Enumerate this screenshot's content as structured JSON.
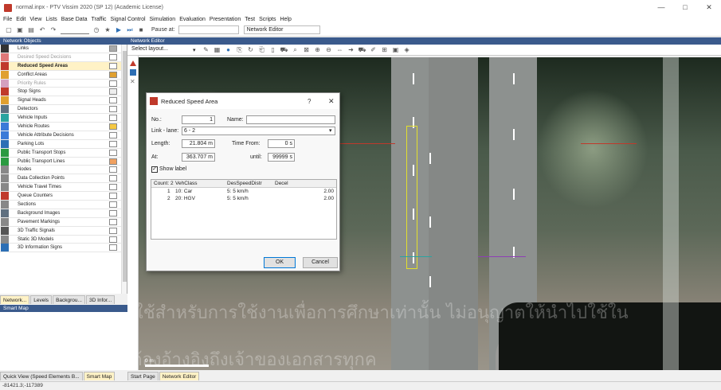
{
  "window": {
    "title": "normal.inpx - PTV Vissim 2020 (SP 12) (Academic License)",
    "minimize": "—",
    "maximize": "□",
    "close": "✕"
  },
  "menu": [
    "File",
    "Edit",
    "View",
    "Lists",
    "Base Data",
    "Traffic",
    "Signal Control",
    "Simulation",
    "Evaluation",
    "Presentation",
    "Test",
    "Scripts",
    "Help"
  ],
  "toolbar": {
    "pause_at_label": "Pause at:",
    "pause_at_value": "",
    "layout_combo": "Network Editor"
  },
  "network_objects": {
    "header": "Network Objects",
    "items": [
      {
        "label": "Links",
        "dim": false,
        "selected": false
      },
      {
        "label": "Desired Speed Decisions",
        "dim": true,
        "selected": false
      },
      {
        "label": "Reduced Speed Areas",
        "dim": false,
        "selected": true
      },
      {
        "label": "Conflict Areas",
        "dim": false,
        "selected": false
      },
      {
        "label": "Priority Rules",
        "dim": true,
        "selected": false
      },
      {
        "label": "Stop Signs",
        "dim": false,
        "selected": false
      },
      {
        "label": "Signal Heads",
        "dim": false,
        "selected": false
      },
      {
        "label": "Detectors",
        "dim": false,
        "selected": false
      },
      {
        "label": "Vehicle Inputs",
        "dim": false,
        "selected": false
      },
      {
        "label": "Vehicle Routes",
        "dim": false,
        "selected": false
      },
      {
        "label": "Vehicle Attribute Decisions",
        "dim": false,
        "selected": false
      },
      {
        "label": "Parking Lots",
        "dim": false,
        "selected": false
      },
      {
        "label": "Public Transport Stops",
        "dim": false,
        "selected": false
      },
      {
        "label": "Public Transport Lines",
        "dim": false,
        "selected": false
      },
      {
        "label": "Nodes",
        "dim": false,
        "selected": false
      },
      {
        "label": "Data Collection Points",
        "dim": false,
        "selected": false
      },
      {
        "label": "Vehicle Travel Times",
        "dim": false,
        "selected": false
      },
      {
        "label": "Queue Counters",
        "dim": false,
        "selected": false
      },
      {
        "label": "Sections",
        "dim": false,
        "selected": false
      },
      {
        "label": "Background Images",
        "dim": false,
        "selected": false
      },
      {
        "label": "Pavement Markings",
        "dim": false,
        "selected": false
      },
      {
        "label": "3D Traffic Signals",
        "dim": false,
        "selected": false
      },
      {
        "label": "Static 3D Models",
        "dim": false,
        "selected": false
      },
      {
        "label": "3D Information Signs",
        "dim": false,
        "selected": false
      }
    ],
    "tabs": [
      "Network...",
      "Levels",
      "Backgrou...",
      "3D Infor..."
    ]
  },
  "smart_map": {
    "header": "Smart Map",
    "tabs": [
      "Quick View (Speed Elements B...",
      "Smart Map"
    ]
  },
  "network_editor": {
    "header": "Network Editor",
    "layout_placeholder": "Select layout...",
    "tabs": [
      "Start Page",
      "Network Editor"
    ],
    "scale_label": "0 m"
  },
  "dialog": {
    "title": "Reduced Speed Area",
    "help": "?",
    "close": "✕",
    "no_label": "No.:",
    "no_value": "1",
    "name_label": "Name:",
    "name_value": "",
    "link_lane_label": "Link - lane:",
    "link_lane_value": "6 - 2",
    "length_label": "Length:",
    "length_value": "21.804 m",
    "at_label": "At:",
    "at_value": "363.707 m",
    "time_from_label": "Time From:",
    "time_from_value": "0 s",
    "until_label": "until:",
    "until_value": "99999 s",
    "show_label": "Show label",
    "grid": {
      "headers": [
        "Count: 2",
        "VehClass",
        "DesSpeedDistr",
        "Decel"
      ],
      "rows": [
        {
          "n": "1",
          "vehclass": "10: Car",
          "speed": "5: 5 km/h",
          "decel": "2.00"
        },
        {
          "n": "2",
          "vehclass": "20: HGV",
          "speed": "5: 5 km/h",
          "decel": "2.00"
        }
      ]
    },
    "ok": "OK",
    "cancel": "Cancel"
  },
  "watermark": {
    "line1": "ใช้สำหรับการใช้งานเพื่อการศึกษาเท่านั้น ไม่อนุญาตให้นำไปใช้ใน",
    "line2": "สิน อีกทั้งห้าม                          และต้องอ้างอิงถึงเจ้าของเอกสารทุกค"
  },
  "status": {
    "coords": "-81421.3;-117389"
  },
  "colors": {
    "panel_header": "#3a5a8c",
    "selected_row": "#fff2c6",
    "accent": "#0078d7"
  }
}
